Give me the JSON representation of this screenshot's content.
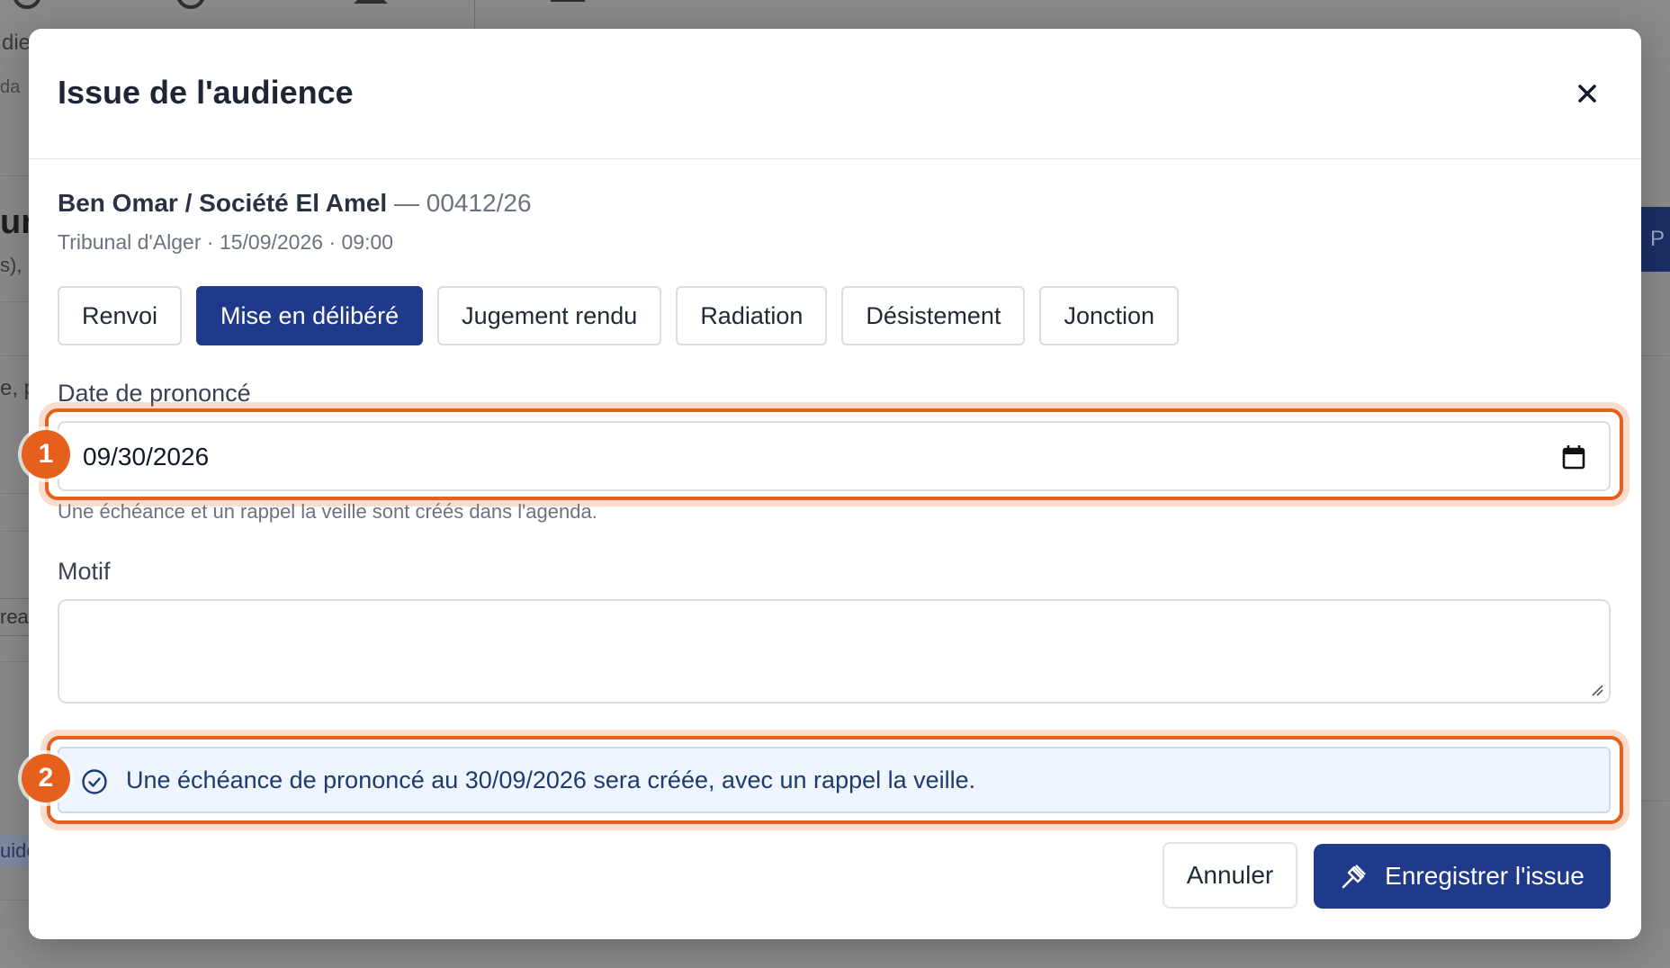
{
  "background": {
    "fragments": [
      "die",
      "da",
      "ur",
      "s),",
      "e, p",
      "rea",
      "uido"
    ],
    "side_button": "P"
  },
  "modal": {
    "title": "Issue de l'audience",
    "case": {
      "name": "Ben Omar / Société El Amel",
      "separator": "—",
      "number": "00412/26",
      "meta": "Tribunal d'Alger · 15/09/2026 · 09:00"
    },
    "outcome_tabs": [
      {
        "label": "Renvoi",
        "active": false
      },
      {
        "label": "Mise en délibéré",
        "active": true
      },
      {
        "label": "Jugement rendu",
        "active": false
      },
      {
        "label": "Radiation",
        "active": false
      },
      {
        "label": "Désistement",
        "active": false
      },
      {
        "label": "Jonction",
        "active": false
      }
    ],
    "date_field": {
      "label": "Date de prononcé",
      "value": "09/30/2026",
      "hint": "Une échéance et un rappel la veille sont créés dans l'agenda."
    },
    "motif_field": {
      "label": "Motif",
      "value": ""
    },
    "info": "Une échéance de prononcé au 30/09/2026 sera créée, avec un rappel la veille.",
    "buttons": {
      "cancel": "Annuler",
      "save": "Enregistrer l'issue"
    }
  },
  "annotations": [
    {
      "number": "1"
    },
    {
      "number": "2"
    }
  ],
  "colors": {
    "primary": "#1f3a8a",
    "annotation": "#e4601c",
    "info_bg": "#eef5fe"
  }
}
